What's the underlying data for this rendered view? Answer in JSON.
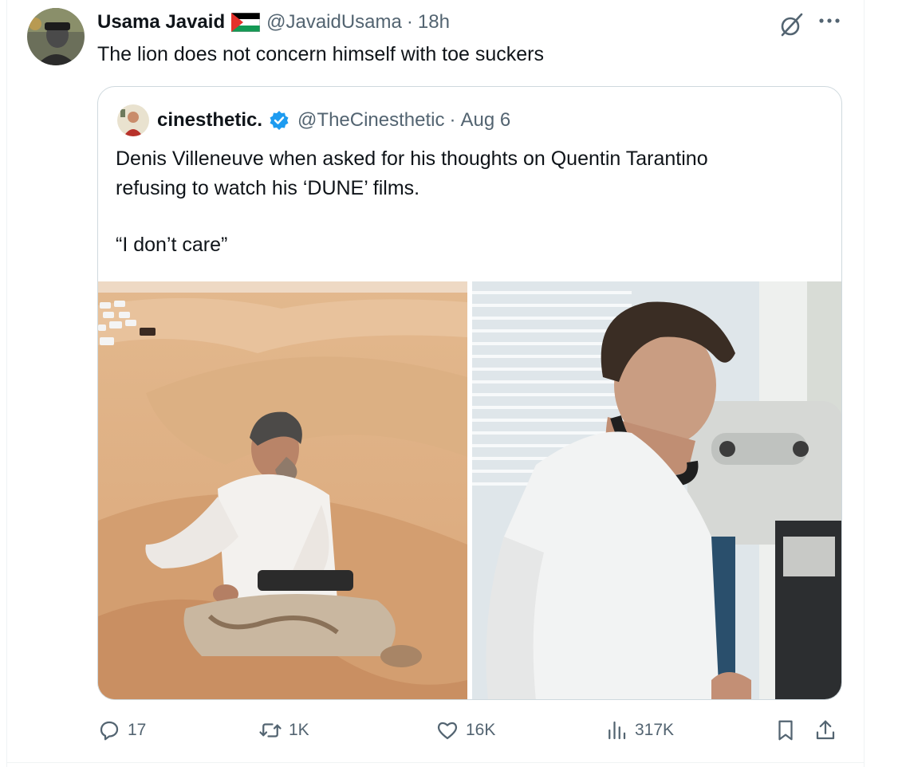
{
  "tweet": {
    "author_name": "Usama Javaid",
    "handle": "@JavaidUsama",
    "separator": "·",
    "time": "18h",
    "text": "The lion does not concern himself with toe suckers",
    "flag_icon": "palestine-flag-icon"
  },
  "quoted": {
    "author_name": "cinesthetic.",
    "handle": "@TheCinesthetic",
    "separator": "·",
    "date": "Aug 6",
    "text_lines": [
      "Denis Villeneuve when asked for his thoughts on Quentin Tarantino",
      "refusing to watch his ‘DUNE’ films."
    ],
    "quote_line": "“I don’t care”",
    "verified_color": "#1d9bf0"
  },
  "actions": {
    "replies": "17",
    "reposts": "1K",
    "likes": "16K",
    "views": "317K"
  },
  "colors": {
    "text": "#0f1419",
    "secondary": "#536471",
    "border": "#cfd9de",
    "accent": "#1d9bf0"
  }
}
